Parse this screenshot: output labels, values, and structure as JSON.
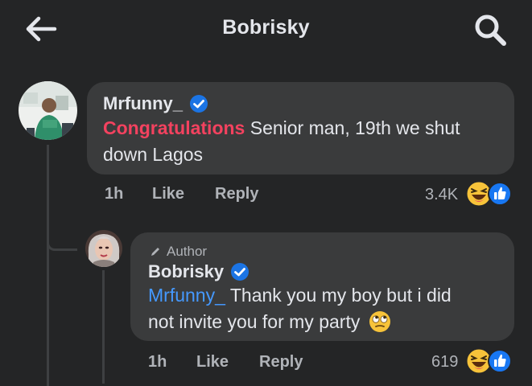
{
  "header": {
    "title": "Bobrisky",
    "back_icon": "back-arrow-icon",
    "search_icon": "search-icon"
  },
  "colors": {
    "background": "#242526",
    "bubble": "#3a3b3c",
    "text": "#e4e6eb",
    "muted": "#b0b3b8",
    "highlight": "#f3425f",
    "mention": "#4599ff",
    "verified": "#1b74e4"
  },
  "comments": [
    {
      "author": "Mrfunny_",
      "verified": true,
      "highlight": "Congratulations",
      "text_line1": " Senior man, 19th we shut",
      "text_line2": "down Lagos",
      "time": "1h",
      "like_label": "Like",
      "reply_label": "Reply",
      "reaction_count": "3.4K",
      "reactions": [
        "haha-icon",
        "like-icon"
      ]
    },
    {
      "author_tag": "Author",
      "author": "Bobrisky",
      "verified": true,
      "mention": "Mrfunny_",
      "text_line1": " Thank you my boy but i did",
      "text_line2": "not invite you for my party",
      "emoji": "eye-roll-emoji-icon",
      "time": "1h",
      "like_label": "Like",
      "reply_label": "Reply",
      "reaction_count": "619",
      "reactions": [
        "haha-icon",
        "like-icon"
      ]
    }
  ]
}
